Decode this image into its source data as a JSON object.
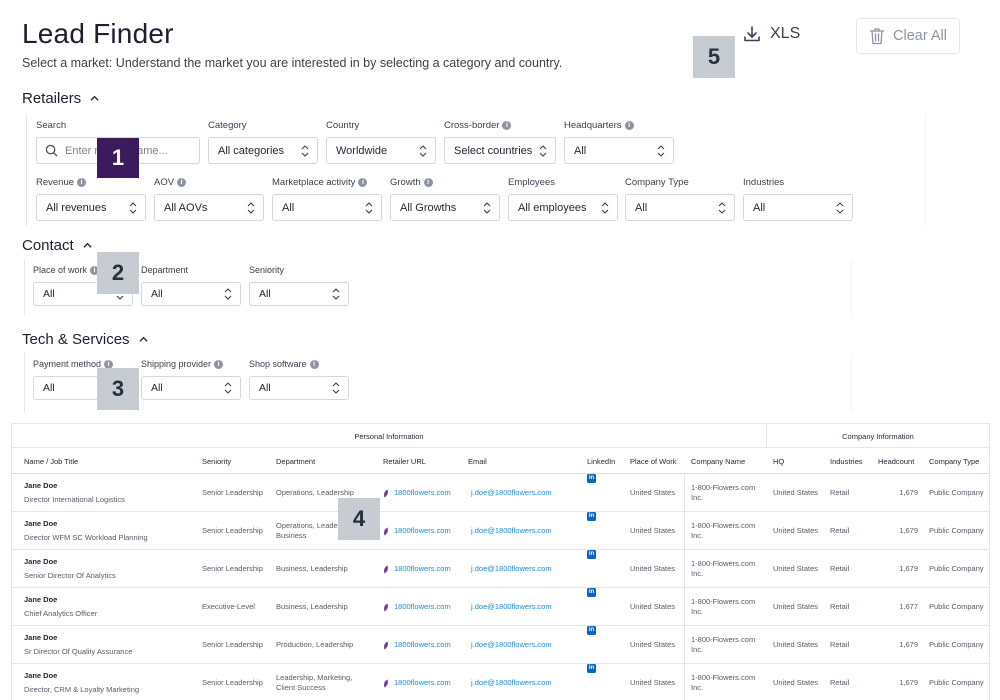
{
  "header": {
    "title": "Lead Finder",
    "subtitle": "Select a market: Understand the market you are interested in by selecting a category and country.",
    "xls_label": "XLS",
    "clear_label": "Clear All"
  },
  "markers": [
    "1",
    "2",
    "3",
    "4",
    "5"
  ],
  "retailers": {
    "title": "Retailers",
    "search": {
      "label": "Search",
      "placeholder": "Enter retailer name..."
    },
    "category": {
      "label": "Category",
      "value": "All categories"
    },
    "country": {
      "label": "Country",
      "value": "Worldwide"
    },
    "cross_border": {
      "label": "Cross-border",
      "value": "Select countries"
    },
    "headquarters": {
      "label": "Headquarters",
      "value": "All"
    },
    "revenue": {
      "label": "Revenue",
      "value": "All revenues"
    },
    "aov": {
      "label": "AOV",
      "value": "All AOVs"
    },
    "marketplace": {
      "label": "Marketplace activity",
      "value": "All"
    },
    "growth": {
      "label": "Growth",
      "value": "All Growths"
    },
    "employees": {
      "label": "Employees",
      "value": "All employees"
    },
    "company_type": {
      "label": "Company Type",
      "value": "All"
    },
    "industries": {
      "label": "Industries",
      "value": "All"
    }
  },
  "contact": {
    "title": "Contact",
    "place_of_work": {
      "label": "Place of work",
      "value": "All"
    },
    "department": {
      "label": "Department",
      "value": "All"
    },
    "seniority": {
      "label": "Seniority",
      "value": "All"
    }
  },
  "tech": {
    "title": "Tech & Services",
    "payment": {
      "label": "Payment method",
      "value": "All"
    },
    "shipping": {
      "label": "Shipping provider",
      "value": "All"
    },
    "shop_software": {
      "label": "Shop software",
      "value": "All"
    }
  },
  "table": {
    "group_personal": "Personal Information",
    "group_company": "Company Information",
    "headers": {
      "name": "Name / Job Title",
      "seniority": "Seniority",
      "department": "Department",
      "retailer_url": "Retailer URL",
      "email": "Email",
      "linkedin": "LinkedIn",
      "place": "Place of Work",
      "company": "Company Name",
      "hq": "HQ",
      "industries": "Industries",
      "headcount": "Headcount",
      "company_type": "Company Type"
    },
    "linkedin_glyph": "in",
    "rows": [
      {
        "name": "Jane Doe",
        "title": "Director International Logistics",
        "seniority": "Senior Leadership",
        "department": "Operations, Leadership",
        "url": "1800flowers.com",
        "email": "j.doe@1800flowers.com",
        "place": "United States",
        "company": "1-800-Flowers.com Inc.",
        "hq": "United States",
        "industries": "Retail",
        "headcount": "1,679",
        "company_type": "Public Company"
      },
      {
        "name": "Jane Doe",
        "title": "Director WFM SC Workload Planning",
        "seniority": "Senior Leadership",
        "department": "Operations, Leadership, Business",
        "url": "1800flowers.com",
        "email": "j.doe@1800flowers.com",
        "place": "United States",
        "company": "1-800-Flowers.com Inc.",
        "hq": "United States",
        "industries": "Retail",
        "headcount": "1,679",
        "company_type": "Public Company"
      },
      {
        "name": "Jane Doe",
        "title": "Senior Director Of Analytics",
        "seniority": "Senior Leadership",
        "department": "Business, Leadership",
        "url": "1800flowers.com",
        "email": "j.doe@1800flowers.com",
        "place": "United States",
        "company": "1-800-Flowers.com Inc.",
        "hq": "United States",
        "industries": "Retail",
        "headcount": "1,679",
        "company_type": "Public Company"
      },
      {
        "name": "Jane Doe",
        "title": "Chief Analytics Officer",
        "seniority": "Executive-Level",
        "department": "Business, Leadership",
        "url": "1800flowers.com",
        "email": "j.doe@1800flowers.com",
        "place": "United States",
        "company": "1-800-Flowers.com Inc.",
        "hq": "United States",
        "industries": "Retail",
        "headcount": "1,677",
        "company_type": "Public Company"
      },
      {
        "name": "Jane Doe",
        "title": "Sr Director Of Quality Assurance",
        "seniority": "Senior Leadership",
        "department": "Production, Leadership",
        "url": "1800flowers.com",
        "email": "j.doe@1800flowers.com",
        "place": "United States",
        "company": "1-800-Flowers.com Inc.",
        "hq": "United States",
        "industries": "Retail",
        "headcount": "1,679",
        "company_type": "Public Company"
      },
      {
        "name": "Jane Doe",
        "title": "Director, CRM & Loyalty Marketing",
        "seniority": "Senior Leadership",
        "department": "Leadership, Marketing, Client Success",
        "url": "1800flowers.com",
        "email": "j.doe@1800flowers.com",
        "place": "United States",
        "company": "1-800-Flowers.com Inc.",
        "hq": "United States",
        "industries": "Retail",
        "headcount": "1,679",
        "company_type": "Public Company"
      }
    ]
  }
}
